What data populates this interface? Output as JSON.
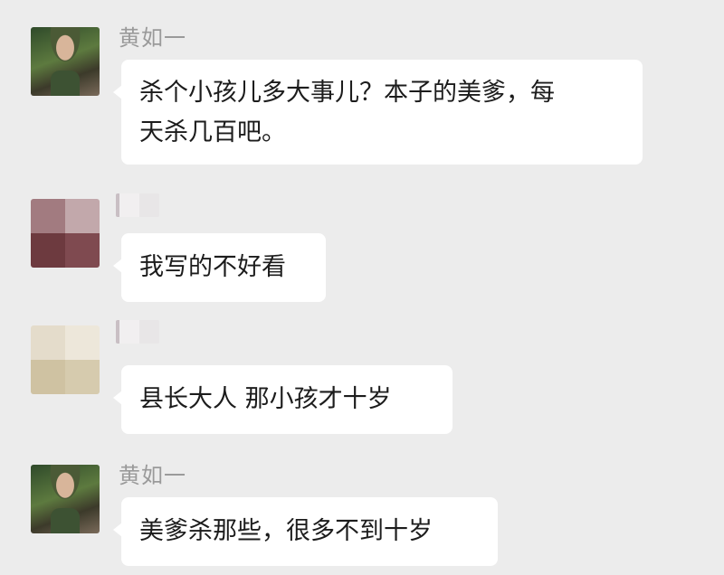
{
  "messages": [
    {
      "sender": "黄如一",
      "avatar_icon": "soldier-avatar-icon",
      "text_line1": "杀个小孩儿多大事儿？本子的美爹，每",
      "text_line2": "天杀几百吧。"
    },
    {
      "sender": "",
      "avatar_icon": "pixelated-avatar-icon",
      "text": "我写的不好看"
    },
    {
      "sender": "",
      "avatar_icon": "pixelated-avatar-icon",
      "text": "县长大人 那小孩才十岁"
    },
    {
      "sender": "黄如一",
      "avatar_icon": "soldier-avatar-icon",
      "text": "美爹杀那些，很多不到十岁"
    }
  ],
  "colors": {
    "background": "#ececec",
    "bubble": "#ffffff",
    "sender_name": "#9a9a9a",
    "avatar2_mosaic": [
      "#a27b80",
      "#c2a8ab",
      "#6d3a3f",
      "#7f4a50"
    ],
    "avatar3_mosaic": [
      "#e4dccb",
      "#ede7da",
      "#cfc2a2",
      "#d6cbae"
    ]
  }
}
